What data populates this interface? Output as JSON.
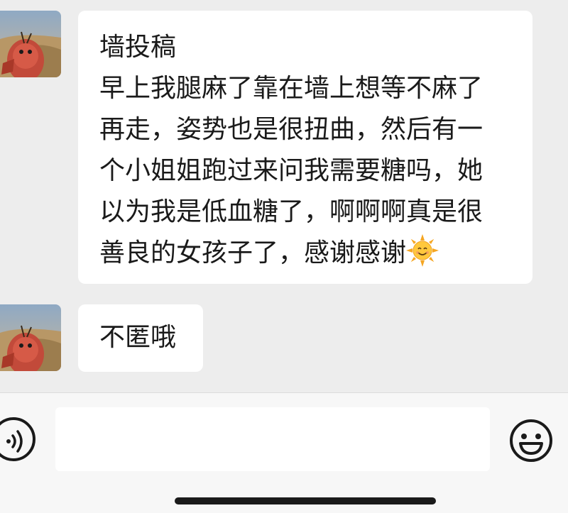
{
  "messages": [
    {
      "sender_avatar": "cartoon-character-avatar",
      "lines": [
        "墙投稿",
        "早上我腿麻了靠在墙上想等不麻了",
        "再走，姿势也是很扭曲，然后有一",
        "个小姐姐跑过来问我需要糖吗，她",
        "以为我是低血糖了，啊啊啊真是很",
        "善良的女孩子了，感谢感谢"
      ],
      "trailing_emoji": "sun-icon"
    },
    {
      "sender_avatar": "cartoon-character-avatar",
      "text": "不匿哦"
    }
  ],
  "input_bar": {
    "value": "",
    "left_icon": "voice-icon",
    "right_icon": "emoji-icon"
  },
  "colors": {
    "chat_background": "#ededed",
    "bubble": "#ffffff",
    "input_bar": "#f7f7f7",
    "text": "#1a1a1a"
  }
}
